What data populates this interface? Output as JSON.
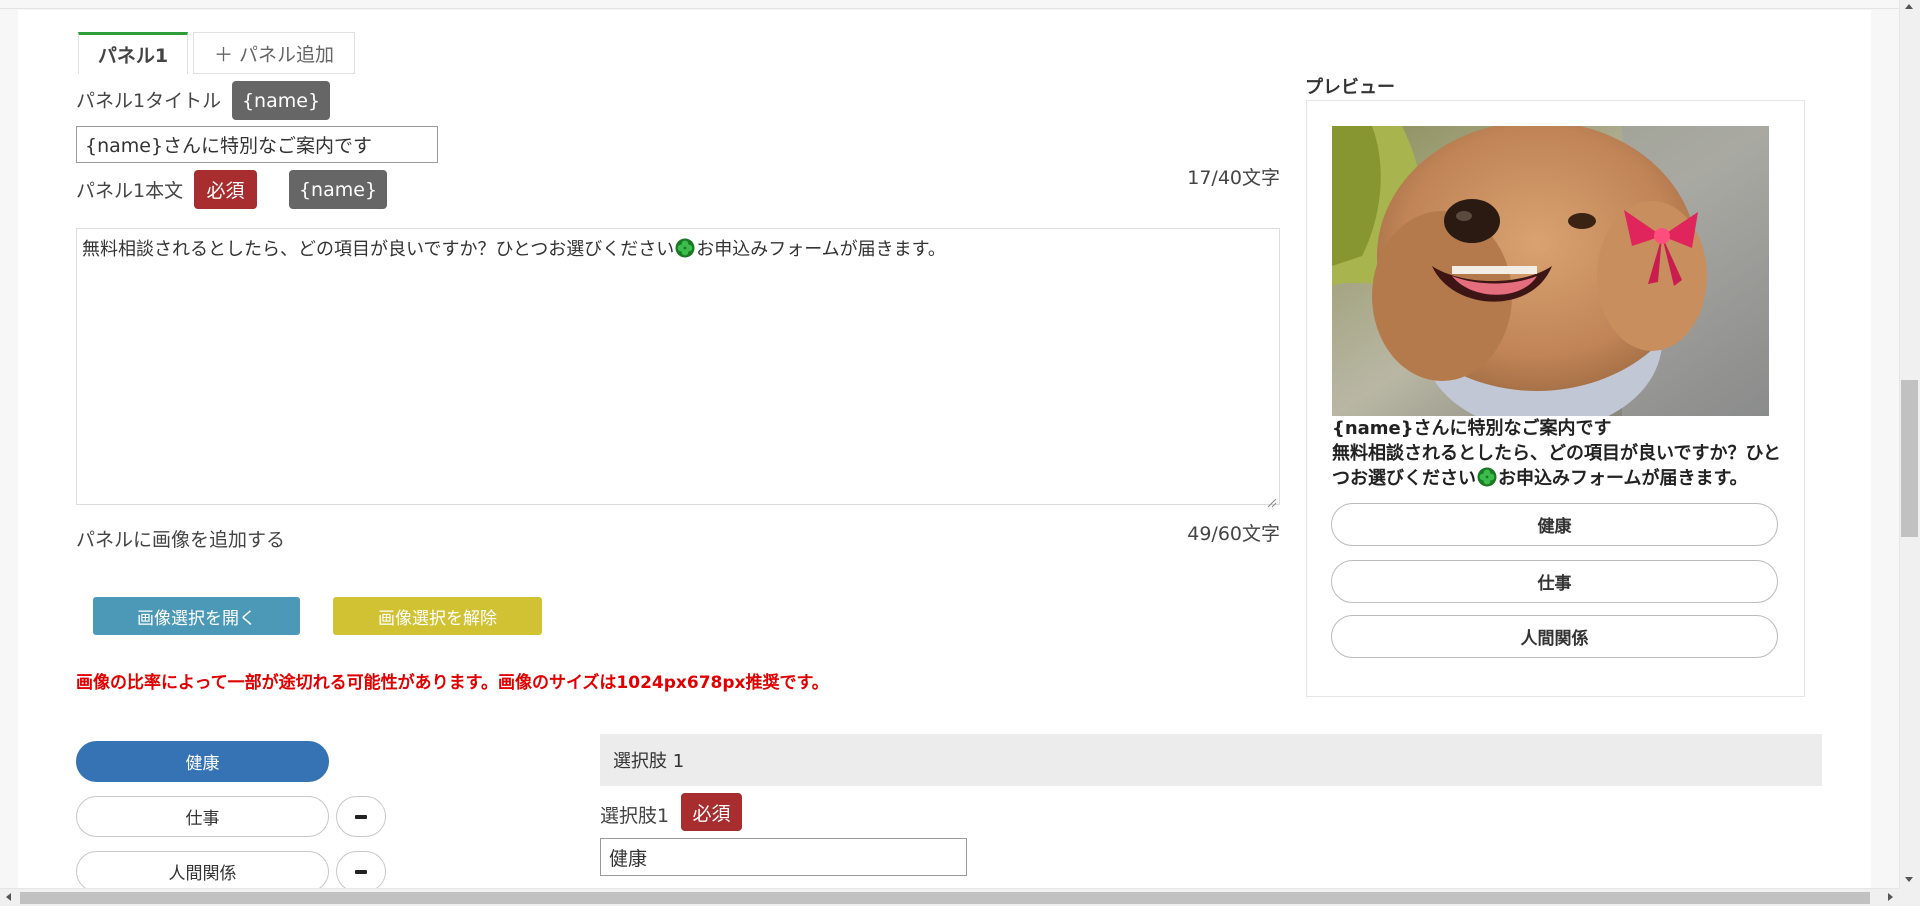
{
  "tabs": {
    "active_label": "パネル1",
    "add_label": "＋ パネル追加"
  },
  "panel": {
    "title_label": "パネル1タイトル",
    "title_name_tag": "{name}",
    "title_value": "{name}さんに特別なご案内です",
    "title_count": "17/40文字",
    "body_label": "パネル1本文",
    "required_badge": "必須",
    "body_name_tag": "{name}",
    "body_text_before": "無料相談されるとしたら、どの項目が良いですか？ひとつお選びください",
    "body_text_after": "お申込みフォームが届きます。",
    "body_count": "49/60文字",
    "add_image_label": "パネルに画像を追加する",
    "open_image_button": "画像選択を開く",
    "clear_image_button": "画像選択を解除",
    "warning_text": "画像の比率によって一部が途切れる可能性があります。画像のサイズは1024px678px推奨です。"
  },
  "preview": {
    "title": "プレビュー",
    "heading": "{name}さんに特別なご案内です",
    "body_before": "無料相談されるとしたら、どの項目が良いですか？ひとつお選びください",
    "body_after": "お申込みフォームが届きます。",
    "buttons": [
      "健康",
      "仕事",
      "人間関係"
    ]
  },
  "choices": {
    "items": [
      "健康",
      "仕事",
      "人間関係"
    ],
    "section_header": "選択肢 1",
    "choice_label": "選択肢1",
    "required_badge": "必須",
    "choice_value": "健康"
  },
  "colors": {
    "accent_blue": "#3573b4",
    "required_red": "#a72d2e",
    "tag_gray": "#666666",
    "tab_green": "#2e9f38",
    "open_button": "#4c99b7",
    "clear_button": "#d1c234",
    "warning_red": "#e00000"
  },
  "icons": {
    "clover": "four-leaf-clover-icon",
    "minus": "minus-icon",
    "resize": "resize-handle-icon"
  }
}
